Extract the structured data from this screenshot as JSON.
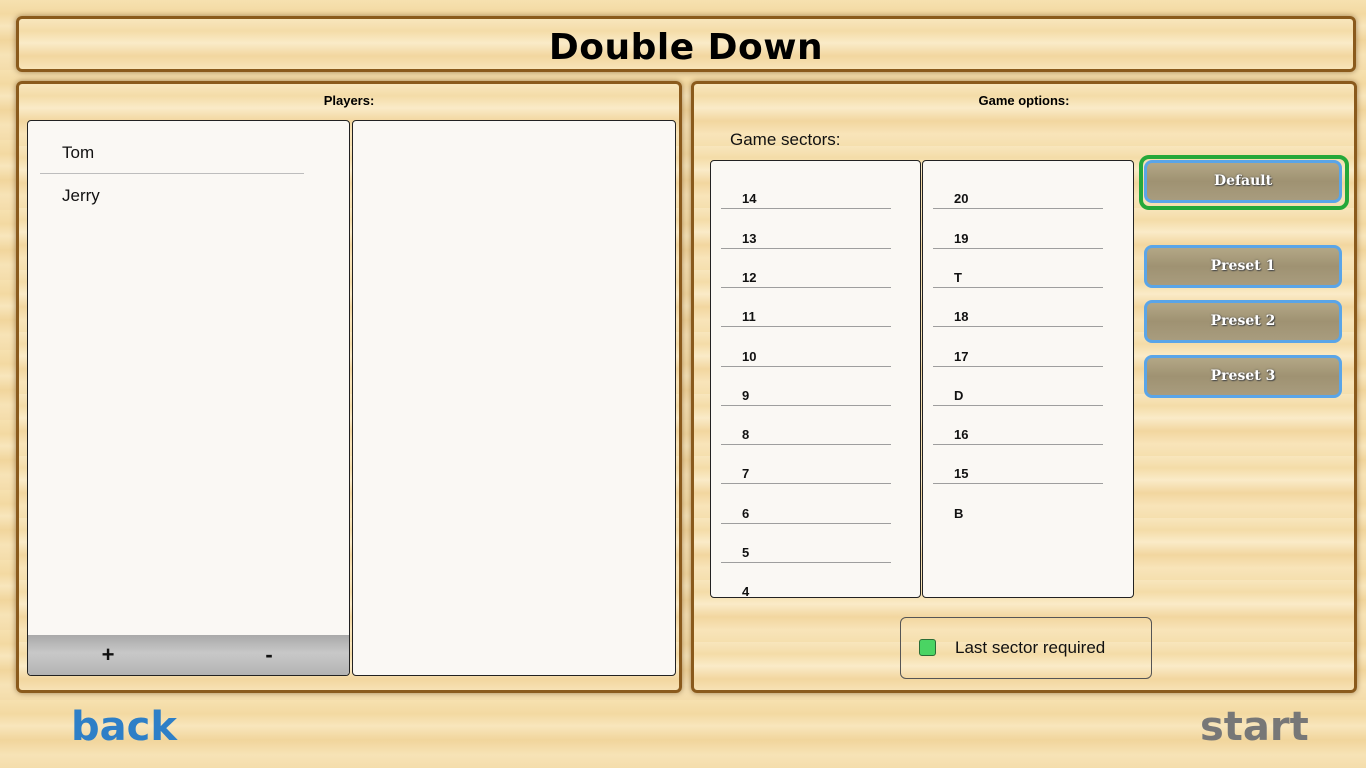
{
  "header": {
    "title": "Double Down"
  },
  "players_panel": {
    "heading": "Players:",
    "players": [
      "Tom",
      "Jerry"
    ],
    "add_label": "+",
    "remove_label": "-"
  },
  "options_panel": {
    "heading": "Game options:",
    "sectors_label": "Game sectors:",
    "sectors_column_1": [
      "14",
      "13",
      "12",
      "11",
      "10",
      "9",
      "8",
      "7",
      "6",
      "5",
      "4"
    ],
    "sectors_column_2": [
      "20",
      "19",
      "T",
      "18",
      "17",
      "D",
      "16",
      "15",
      "B"
    ],
    "presets": {
      "default": "Default",
      "preset1": "Preset 1",
      "preset2": "Preset 2",
      "preset3": "Preset 3"
    },
    "selected_preset": "default",
    "last_sector_required": {
      "label": "Last sector required",
      "checked": true
    }
  },
  "footer": {
    "back_label": "back",
    "start_label": "start"
  },
  "colors": {
    "selected_outline": "#25a83a",
    "preset_border": "#5aa5e8",
    "checkbox": "#4ad463",
    "back_link": "#2e7fc7",
    "start_link": "#777777"
  }
}
